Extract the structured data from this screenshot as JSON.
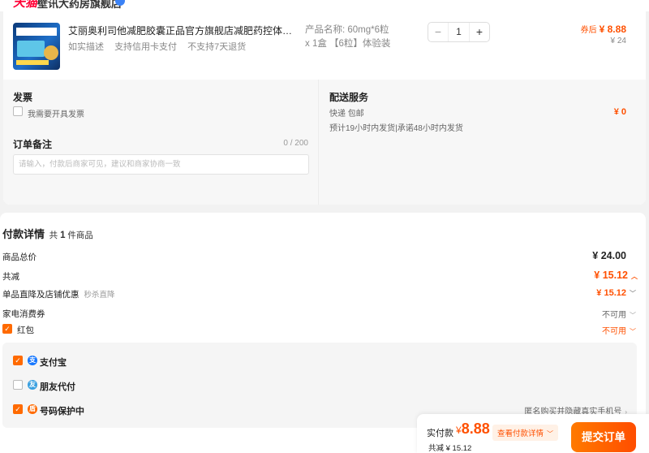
{
  "store": {
    "brand_badge": "天猫",
    "name": "壁讯大药房旗舰店"
  },
  "product": {
    "title": "艾丽奥利司他减肥胶囊正品官方旗舰店减肥药控体重减...",
    "tags": [
      "如实描述",
      "支持信用卡支付",
      "不支持7天退货"
    ],
    "spec_line1": "产品名称: 60mg*6粒",
    "spec_line2": "x 1盒 【6粒】体验装",
    "quantity": "1",
    "qty_minus": "−",
    "qty_plus": "+",
    "price_after_label": "券后",
    "price_after": "¥ 8.88",
    "price_original": "¥ 24"
  },
  "invoice": {
    "title": "发票",
    "checkbox_label": "我需要开具发票"
  },
  "order_note": {
    "title": "订单备注",
    "count": "0 / 200",
    "placeholder": "请输入，付款后商家可见，建议和商家协商一致"
  },
  "shipping": {
    "title": "配送服务",
    "method": "快递 包邮",
    "eta": "预计19小时内发货|承诺48小时内发货",
    "price": "¥ 0"
  },
  "payment_details": {
    "title": "付款详情",
    "count_prefix": "共",
    "count": "1",
    "count_suffix": "件商品",
    "rows": {
      "total_label": "商品总价",
      "total_value": "¥ 24.00",
      "discount_label": "共减",
      "discount_value": "¥ 15.12",
      "store_discount_label": "单品直降及店铺优惠",
      "store_discount_sub": "秒杀直降",
      "store_discount_value": "¥ 15.12",
      "appliance_label": "家电消费券",
      "appliance_value": "不可用",
      "redpacket_label": "红包",
      "redpacket_value": "不可用"
    }
  },
  "payment_methods": {
    "alipay": "支付宝",
    "friend_pay": "朋友代付",
    "number_protect": "号码保护中",
    "number_protect_note": "匿名购买并隐藏真实手机号"
  },
  "footer": {
    "actual_label": "实付款",
    "currency": "¥",
    "amount": "8.88",
    "detail_link": "查看付款详情",
    "saved": "共减 ¥ 15.12",
    "submit": "提交订单"
  },
  "colors": {
    "accent": "#ff5000",
    "checkbox_checked": "#ff6a00",
    "alipay": "#1677ff",
    "friend_pay": "#3aa0e0",
    "protect": "#ff6a00"
  }
}
